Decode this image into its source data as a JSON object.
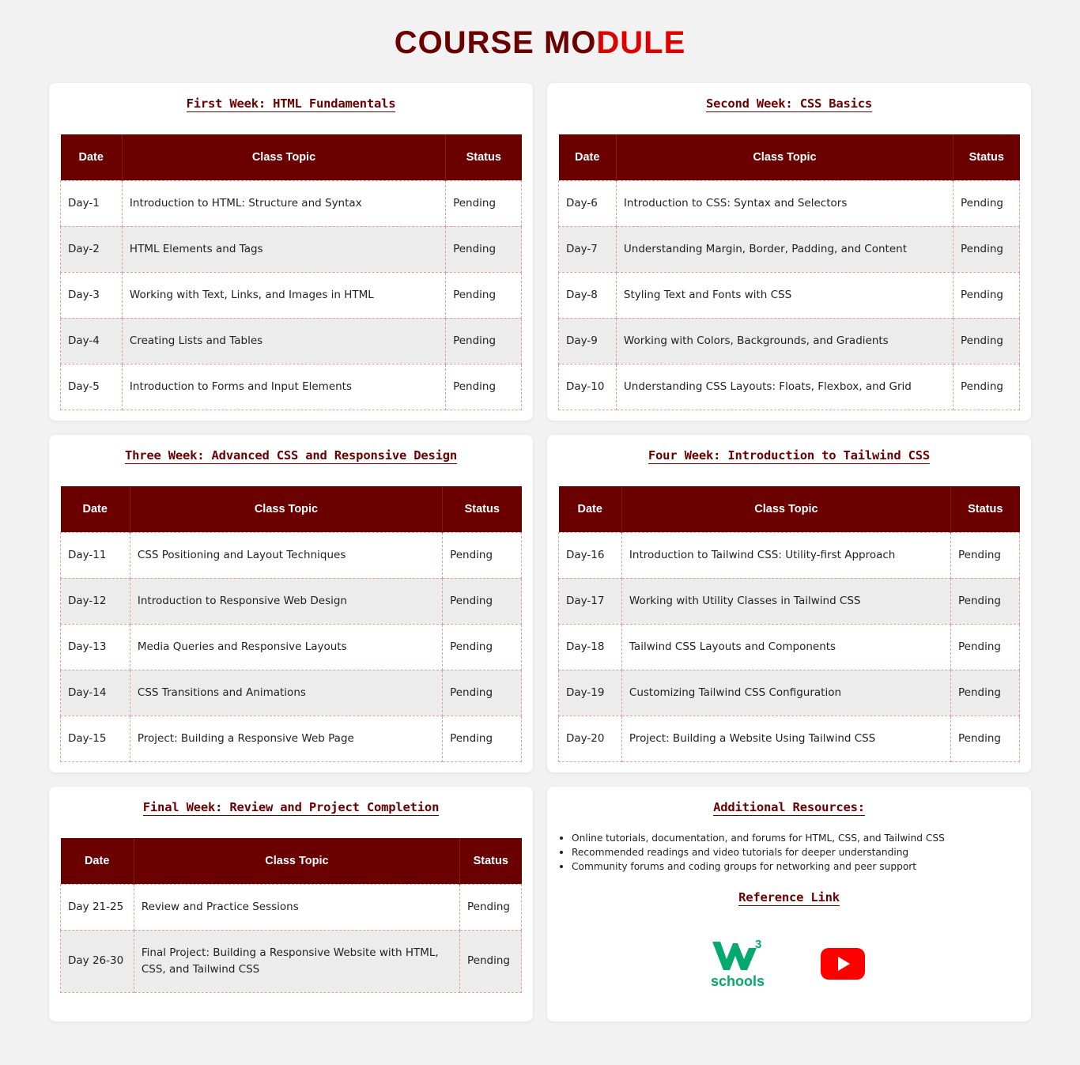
{
  "header": {
    "title_dark": "COURSE MO",
    "title_red": "DULE"
  },
  "colors": {
    "maroon": "#6b0000",
    "red": "#e00000",
    "alt_row": "#ececec",
    "w3_green": "#04aa6d",
    "youtube_red": "#ff0000"
  },
  "columns": {
    "date": "Date",
    "topic": "Class Topic",
    "status": "Status"
  },
  "weeks": [
    {
      "title": "First Week: HTML Fundamentals",
      "rows": [
        {
          "date": "Day-1",
          "topic": "Introduction to HTML: Structure and Syntax",
          "status": "Pending"
        },
        {
          "date": "Day-2",
          "topic": "HTML Elements and Tags",
          "status": "Pending"
        },
        {
          "date": "Day-3",
          "topic": "Working with Text, Links, and Images in HTML",
          "status": "Pending"
        },
        {
          "date": "Day-4",
          "topic": "Creating Lists and Tables",
          "status": "Pending"
        },
        {
          "date": "Day-5",
          "topic": "Introduction to Forms and Input Elements",
          "status": "Pending"
        }
      ]
    },
    {
      "title": "Second Week: CSS Basics",
      "rows": [
        {
          "date": "Day-6",
          "topic": "Introduction to CSS: Syntax and Selectors",
          "status": "Pending"
        },
        {
          "date": "Day-7",
          "topic": "Understanding Margin, Border, Padding, and Content",
          "status": "Pending"
        },
        {
          "date": "Day-8",
          "topic": "Styling Text and Fonts with CSS",
          "status": "Pending"
        },
        {
          "date": "Day-9",
          "topic": "Working with Colors, Backgrounds, and Gradients",
          "status": "Pending"
        },
        {
          "date": "Day-10",
          "topic": "Understanding CSS Layouts: Floats, Flexbox, and Grid",
          "status": "Pending"
        }
      ]
    },
    {
      "title": "Three Week: Advanced CSS and Responsive Design",
      "rows": [
        {
          "date": "Day-11",
          "topic": "CSS Positioning and Layout Techniques",
          "status": "Pending"
        },
        {
          "date": "Day-12",
          "topic": "Introduction to Responsive Web Design",
          "status": "Pending"
        },
        {
          "date": "Day-13",
          "topic": "Media Queries and Responsive Layouts",
          "status": "Pending"
        },
        {
          "date": "Day-14",
          "topic": "CSS Transitions and Animations",
          "status": "Pending"
        },
        {
          "date": "Day-15",
          "topic": "Project: Building a Responsive Web Page",
          "status": "Pending"
        }
      ]
    },
    {
      "title": "Four Week: Introduction to Tailwind CSS",
      "rows": [
        {
          "date": "Day-16",
          "topic": "Introduction to Tailwind CSS: Utility-first Approach",
          "status": "Pending"
        },
        {
          "date": "Day-17",
          "topic": "Working with Utility Classes in Tailwind CSS",
          "status": "Pending"
        },
        {
          "date": "Day-18",
          "topic": "Tailwind CSS Layouts and Components",
          "status": "Pending"
        },
        {
          "date": "Day-19",
          "topic": "Customizing Tailwind CSS Configuration",
          "status": "Pending"
        },
        {
          "date": "Day-20",
          "topic": "Project: Building a Website Using Tailwind CSS",
          "status": "Pending"
        }
      ]
    },
    {
      "title": "Final Week: Review and Project Completion",
      "rows": [
        {
          "date": "Day 21-25",
          "topic": "Review and Practice Sessions",
          "status": "Pending"
        },
        {
          "date": "Day 26-30",
          "topic": "Final Project: Building a Responsive Website with HTML, CSS, and Tailwind CSS",
          "status": "Pending"
        }
      ]
    }
  ],
  "resources": {
    "title": "Additional Resources:",
    "items": [
      "Online tutorials, documentation, and forums for HTML, CSS, and Tailwind CSS",
      "Recommended readings and video tutorials for deeper understanding",
      "Community forums and coding groups for networking and peer support"
    ],
    "reference_title": "Reference Link",
    "links": [
      {
        "name": "w3schools",
        "icon": "w3schools-logo-icon",
        "logo_text": "schools",
        "logo_sup": "3"
      },
      {
        "name": "youtube",
        "icon": "youtube-logo-icon"
      }
    ]
  }
}
